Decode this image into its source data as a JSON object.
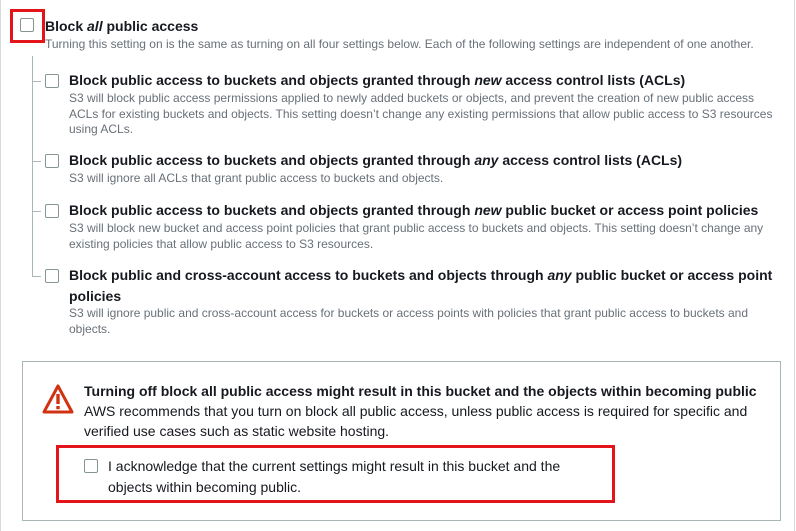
{
  "block_all": {
    "title_prefix": "Block ",
    "title_em": "all",
    "title_suffix": " public access",
    "description": "Turning this setting on is the same as turning on all four settings below. Each of the following settings are independent of one another.",
    "checked": false
  },
  "settings": [
    {
      "title_prefix": "Block public access to buckets and objects granted through ",
      "title_em": "new",
      "title_suffix": " access control lists (ACLs)",
      "description": "S3 will block public access permissions applied to newly added buckets or objects, and prevent the creation of new public access ACLs for existing buckets and objects. This setting doesn’t change any existing permissions that allow public access to S3 resources using ACLs.",
      "checked": false
    },
    {
      "title_prefix": "Block public access to buckets and objects granted through ",
      "title_em": "any",
      "title_suffix": " access control lists (ACLs)",
      "description": "S3 will ignore all ACLs that grant public access to buckets and objects.",
      "checked": false
    },
    {
      "title_prefix": "Block public access to buckets and objects granted through ",
      "title_em": "new",
      "title_suffix": " public bucket or access point policies",
      "description": "S3 will block new bucket and access point policies that grant public access to buckets and objects. This setting doesn’t change any existing policies that allow public access to S3 resources.",
      "checked": false
    },
    {
      "title_prefix": "Block public and cross-account access to buckets and objects through ",
      "title_em": "any",
      "title_suffix": " public bucket or access point policies",
      "description": "S3 will ignore public and cross-account access for buckets or access points with policies that grant public access to buckets and objects.",
      "checked": false
    }
  ],
  "warning": {
    "title": "Turning off block all public access might result in this bucket and the objects within becoming public",
    "text": "AWS recommends that you turn on block all public access, unless public access is required for specific and verified use cases such as static website hosting.",
    "acknowledge_label": "I acknowledge that the current settings might result in this bucket and the objects within becoming public.",
    "acknowledged": false
  },
  "colors": {
    "highlight": "#e4141b",
    "warning_icon": "#d13212",
    "description_text": "#687078",
    "tree_line": "#aab7b8"
  }
}
